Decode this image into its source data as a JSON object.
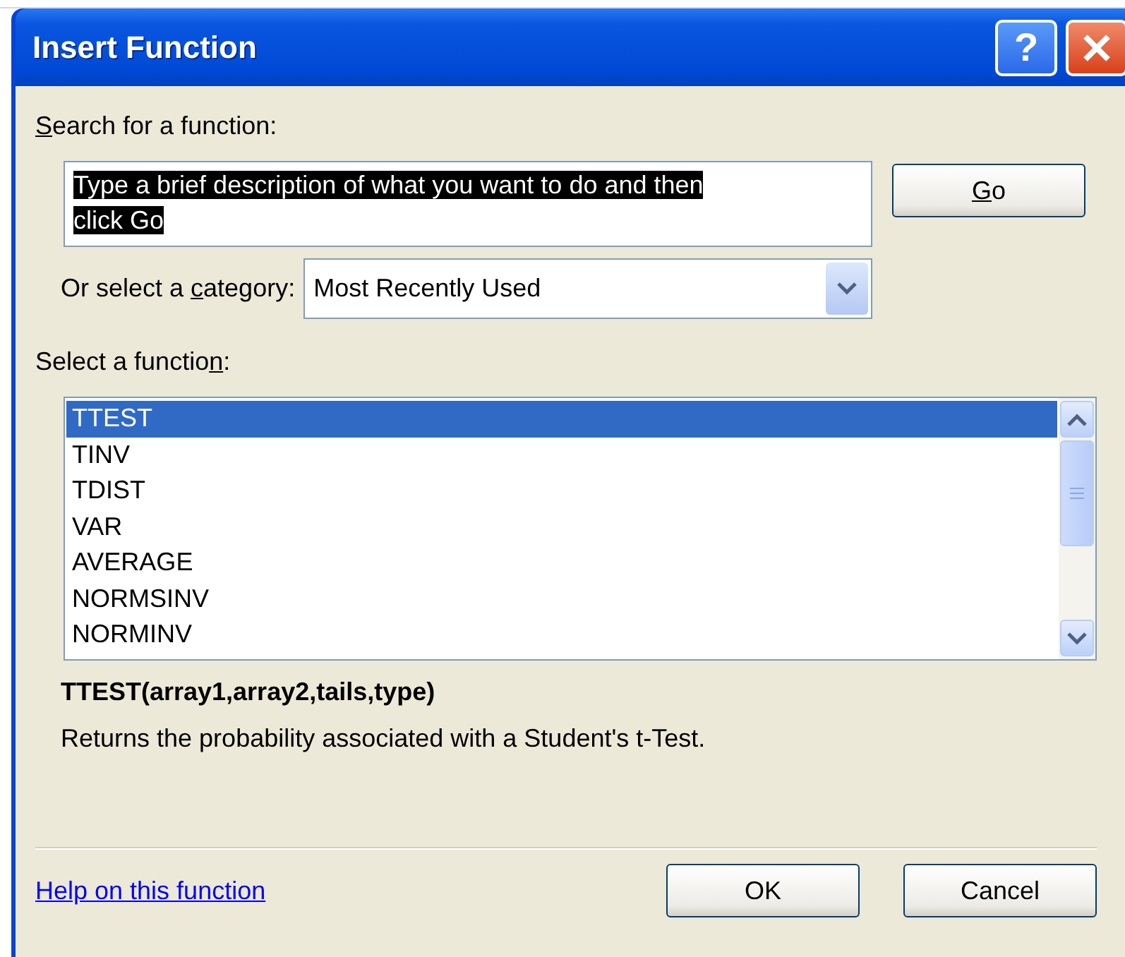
{
  "window": {
    "title": "Insert Function",
    "help_button": "?"
  },
  "search": {
    "label": {
      "key": "S",
      "after": "earch for a function:"
    },
    "value": "Type a brief description of what you want to do and then click Go",
    "value_selected": true,
    "go_button": {
      "key": "G",
      "after": "o"
    }
  },
  "category": {
    "label": {
      "before": "Or select a ",
      "key": "c",
      "after": "ategory:"
    },
    "value": "Most Recently Used"
  },
  "functions": {
    "label": {
      "before": "Select a functio",
      "key": "n",
      "after": ":"
    },
    "items": [
      {
        "name": "TTEST",
        "selected": true
      },
      {
        "name": "TINV",
        "selected": false
      },
      {
        "name": "TDIST",
        "selected": false
      },
      {
        "name": "VAR",
        "selected": false
      },
      {
        "name": "AVERAGE",
        "selected": false
      },
      {
        "name": "NORMSINV",
        "selected": false
      },
      {
        "name": "NORMINV",
        "selected": false
      }
    ]
  },
  "signature": "TTEST(array1,array2,tails,type)",
  "description": "Returns the probability associated with a Student's t-Test.",
  "help_link": "Help on this function",
  "buttons": [
    "OK",
    "Cancel"
  ]
}
